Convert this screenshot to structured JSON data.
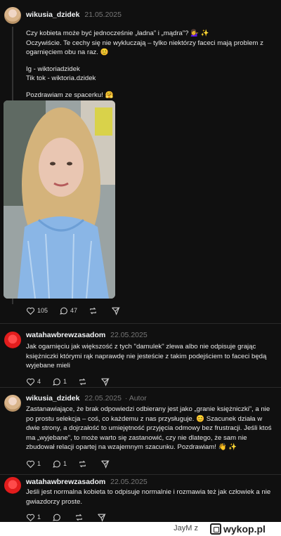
{
  "posts": [
    {
      "username": "wikusia_dzidek",
      "date": "21.05.2025",
      "paragraphs": [
        "Czy kobieta może być jednocześnie „ładna” i „mądra”? 💁‍♀️ ✨",
        "Oczywiście. Te cechy się nie wykluczają – tylko niektórzy faceci mają problem z ogarnięciem obu na raz. 😊",
        "Ig - wiktoriadzidek\nTik tok - wiktoria.dzidek",
        "Pozdrawiam ze spacerku! 🤗"
      ],
      "likes": "105",
      "comments": "47",
      "avatar_icon": "avatar-girl-icon"
    },
    {
      "username": "watahawbrewzasadom",
      "date": "22.05.2025",
      "text": "Jak ogarnięciu jak większość z tych \"damulek\" zlewa albo nie odpisuje grając księżniczki którymi rąk naprawdę nie jesteście z takim podejściem to faceci będą wyjebane mieli",
      "likes": "4",
      "comments": "1"
    },
    {
      "username": "wikusia_dzidek",
      "date": "22.05.2025",
      "author_badge": "· Autor",
      "text": "Zastanawiające, że brak odpowiedzi odbierany jest jako „granie księżniczki”, a nie po prostu selekcja – coś, co każdemu z nas przysługuje. 😊 Szacunek działa w dwie strony, a dojrzałość to umiejętność przyjęcia odmowy bez frustracji. Jeśli ktoś ma „wyjebane”, to może warto się zastanowić, czy nie dlatego, że sam nie zbudował relacji opartej na wzajemnym szacunku. Pozdrawiam! 👋 ✨",
      "likes": "1",
      "comments": "1"
    },
    {
      "username": "watahawbrewzasadom",
      "date": "22.05.2025",
      "text": "Jeśli jest normalna kobieta to odpisuje normalnie i rozmawia też jak człowiek a nie gwiazdorzy proste.",
      "likes": "1",
      "comments": ""
    }
  ],
  "footer": {
    "user": "JayM",
    "separator": "z",
    "logo_text": "wykop.pl"
  },
  "colors": {
    "background": "#101010",
    "text": "#f3f5f7",
    "muted": "#777777"
  }
}
